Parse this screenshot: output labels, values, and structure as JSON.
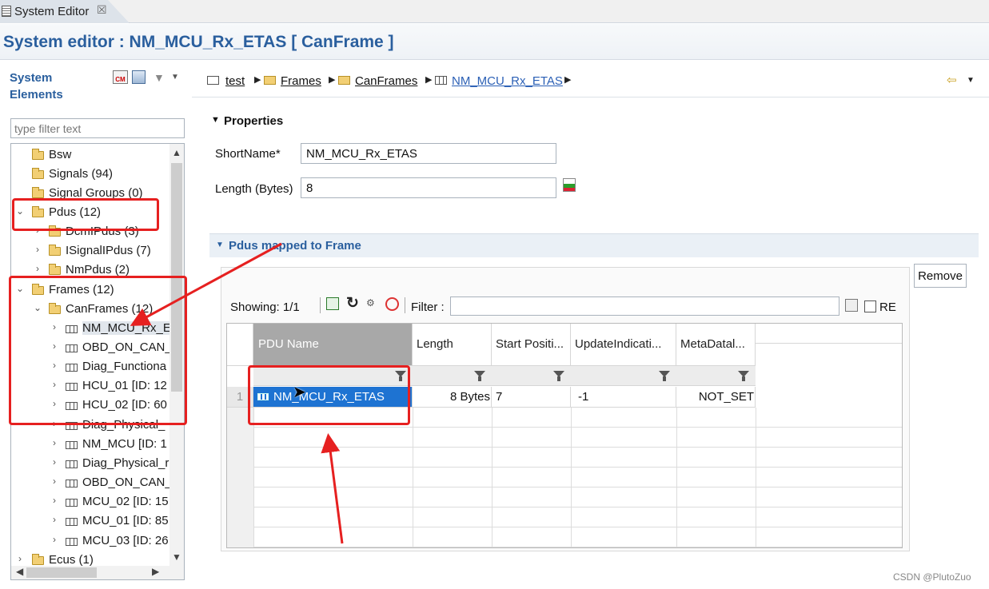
{
  "tab": {
    "label": "System Editor",
    "close": "☒"
  },
  "page_title": "System editor : NM_MCU_Rx_ETAS [ CanFrame ]",
  "left_panel": {
    "title_line1": "System",
    "title_line2": "Elements",
    "filter_placeholder": "type filter text",
    "tree": [
      {
        "label": "Bsw"
      },
      {
        "label": "Signals (94)"
      },
      {
        "label": "Signal Groups (0)"
      },
      {
        "label": "Pdus (12)"
      },
      {
        "label": "DcmIPdus (3)"
      },
      {
        "label": "ISignalIPdus (7)"
      },
      {
        "label": "NmPdus (2)"
      },
      {
        "label": "Frames (12)"
      },
      {
        "label": "CanFrames (12)"
      },
      {
        "label": "NM_MCU_Rx_E"
      },
      {
        "label": "OBD_ON_CAN_"
      },
      {
        "label": "Diag_Functiona"
      },
      {
        "label": "HCU_01 [ID: 12"
      },
      {
        "label": "HCU_02 [ID: 60"
      },
      {
        "label": "Diag_Physical_"
      },
      {
        "label": "NM_MCU [ID: 1"
      },
      {
        "label": "Diag_Physical_r"
      },
      {
        "label": "OBD_ON_CAN_"
      },
      {
        "label": "MCU_02 [ID: 15"
      },
      {
        "label": "MCU_01 [ID: 85"
      },
      {
        "label": "MCU_03 [ID: 26"
      },
      {
        "label": "Ecus (1)"
      }
    ]
  },
  "breadcrumb": {
    "items": [
      "test",
      "Frames",
      "CanFrames",
      "NM_MCU_Rx_ETAS"
    ]
  },
  "properties": {
    "title": "Properties",
    "shortname_label": "ShortName*",
    "shortname_value": "NM_MCU_Rx_ETAS",
    "length_label": "Length (Bytes)",
    "length_value": "8"
  },
  "pdus_section": {
    "title": "Pdus mapped to Frame",
    "remove_label": "Remove",
    "showing": "Showing: 1/1",
    "filter_label": "Filter :",
    "re_label": "RE",
    "columns": [
      "PDU Name",
      "Length",
      "Start Positi...",
      "UpdateIndicati...",
      "MetaDatal..."
    ],
    "rows": [
      {
        "index": "1",
        "pdu_name": "NM_MCU_Rx_ETAS",
        "length": "8 Bytes",
        "start": "7",
        "update": "-1",
        "meta": "NOT_SET"
      }
    ]
  },
  "watermark": "CSDN @PlutoZuo",
  "colors": {
    "title_blue": "#2a5f9e",
    "selection_blue": "#1e73d2",
    "annotation_red": "#e62020"
  }
}
